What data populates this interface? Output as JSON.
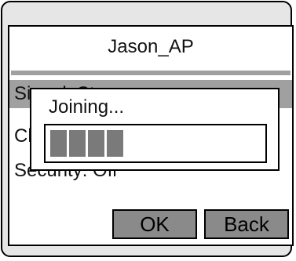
{
  "network_ssid": "Jason_AP",
  "menu_items": [
    {
      "label": "Signal: Strong",
      "selected": true
    },
    {
      "label": "Channel: 6",
      "selected": false
    },
    {
      "label": "Security: Off",
      "selected": false
    }
  ],
  "buttons": {
    "ok_label": "OK",
    "back_label": "Back"
  },
  "dialog": {
    "message": "Joining...",
    "progress_percent": 43
  },
  "colors": {
    "frame": "#e6e6e6",
    "highlight": "#a0a0a0",
    "button": "#8a8a8a",
    "progress_fill": "#7a7a7a"
  }
}
